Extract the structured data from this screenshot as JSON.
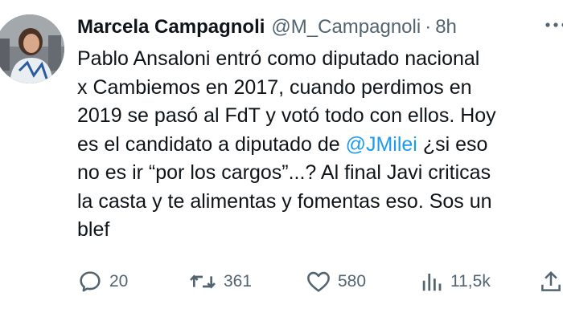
{
  "author": {
    "name": "Marcela Campagnoli",
    "handle": "@M_Campagnoli",
    "separator": "·",
    "time": "8h"
  },
  "tweet": {
    "lines": [
      "Pablo Ansaloni entró como diputado nacional",
      "x Cambiemos en 2017, cuando perdimos en",
      "2019 se pasó al FdT y votó todo con ellos. Hoy",
      "es el candidato a diputado de ",
      "no es ir “por los cargos”...? Al final Javi criticas",
      "la casta y te alimentas y fomentas eso. Sos un",
      "blef"
    ],
    "mention": "@JMilei",
    "line4_tail": " ¿si eso"
  },
  "actions": {
    "reply_count": "20",
    "retweet_count": "361",
    "like_count": "580",
    "views_count": "11,5k"
  },
  "icons": {
    "reply": "reply-icon",
    "retweet": "retweet-icon",
    "like": "heart-icon",
    "views": "views-icon",
    "share": "share-icon",
    "more": "more-icon"
  },
  "colors": {
    "text": "#0f1419",
    "secondary": "#536471",
    "link": "#1d9bf0"
  }
}
